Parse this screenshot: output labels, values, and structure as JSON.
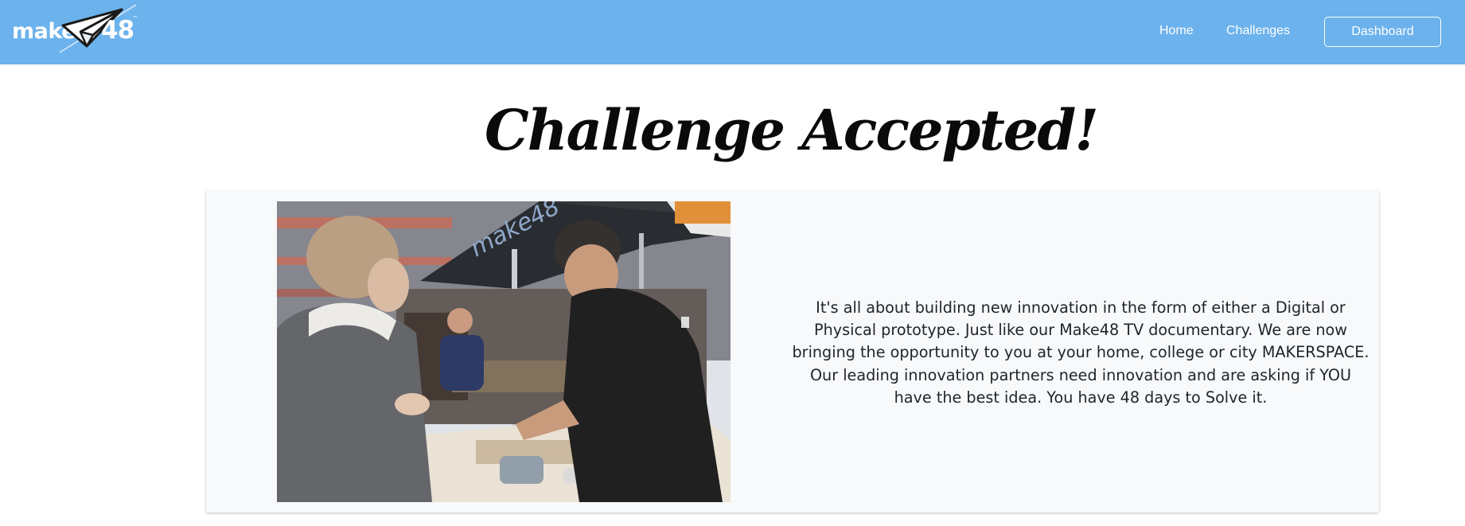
{
  "navbar": {
    "logo": {
      "text_make": "make",
      "text_number": "48",
      "trademark": "™",
      "icon": "paper-plane-icon"
    },
    "links": [
      {
        "label": "Home"
      },
      {
        "label": "Challenges"
      }
    ],
    "dashboard_label": "Dashboard",
    "background_color": "#6cb2ec"
  },
  "hero": {
    "title": "Challenge Accepted!"
  },
  "card": {
    "image_alt": "Two makers working on a prototype under a Make48 tent",
    "description": "It's all about building new innovation in the form of either a Digital or Physical prototype. Just like our Make48 TV documentary. We are now bringing the opportunity to you at your home, college or city MAKERSPACE. Our leading innovation partners need innovation and are asking if YOU have the best idea. You have 48 days to Solve it.",
    "background_color": "#f8f9fa"
  }
}
